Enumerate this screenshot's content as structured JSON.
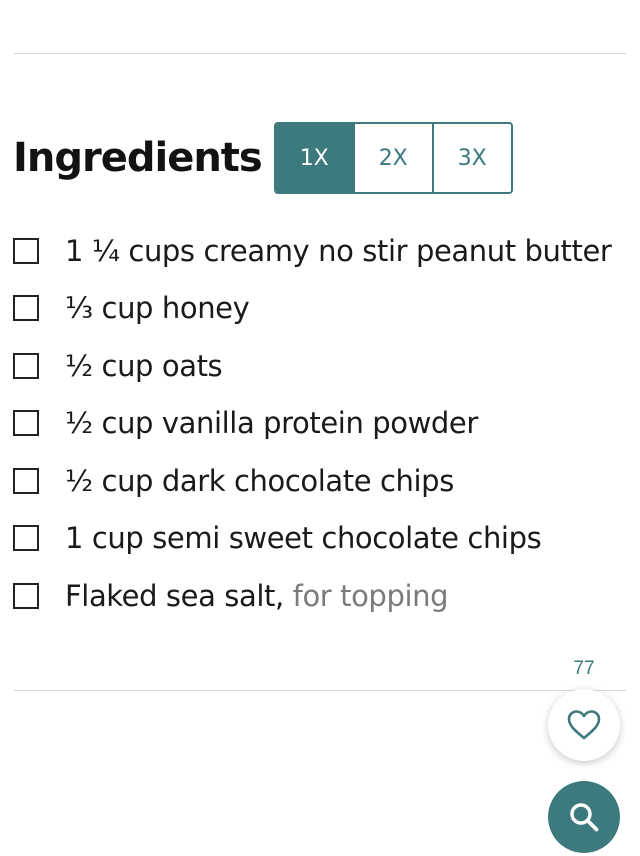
{
  "heading": "Ingredients",
  "scale": {
    "options": [
      "1X",
      "2X",
      "3X"
    ],
    "selected": "1X"
  },
  "ingredients": [
    {
      "text": "1 ¼ cups creamy no stir peanut butter",
      "note": ""
    },
    {
      "text": "⅓ cup honey",
      "note": ""
    },
    {
      "text": "½ cup oats",
      "note": ""
    },
    {
      "text": "½ cup vanilla protein powder",
      "note": ""
    },
    {
      "text": "½ cup dark chocolate chips",
      "note": ""
    },
    {
      "text": "1 cup semi sweet chocolate chips",
      "note": ""
    },
    {
      "text": "Flaked sea salt,",
      "note": " for topping"
    }
  ],
  "likes": {
    "count": "77",
    "icon": "heart-icon"
  },
  "search": {
    "icon": "search-icon"
  },
  "colors": {
    "accent": "#3d7a7d",
    "note_text": "#7b7b7b",
    "divider": "#d8d8d8"
  }
}
